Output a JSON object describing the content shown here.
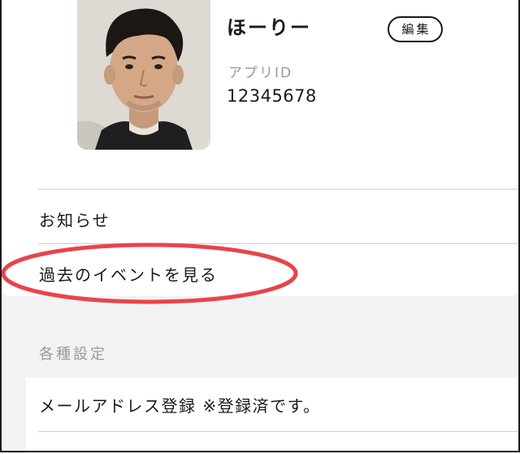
{
  "profile": {
    "name": "ほーりー",
    "edit_label": "編集",
    "app_id_label": "アプリID",
    "app_id_value": "12345678"
  },
  "menu": {
    "items": [
      {
        "label": "お知らせ"
      },
      {
        "label": "過去のイベントを見る"
      }
    ],
    "highlight_color": "#e8444a"
  },
  "settings": {
    "section_label": "各種設定",
    "items": [
      {
        "label": "メールアドレス登録 ※登録済です。"
      }
    ]
  },
  "colors": {
    "background": "#f2f2f2",
    "card": "#ffffff",
    "muted_text": "#9a9a9a",
    "divider": "#cfcfcf"
  }
}
